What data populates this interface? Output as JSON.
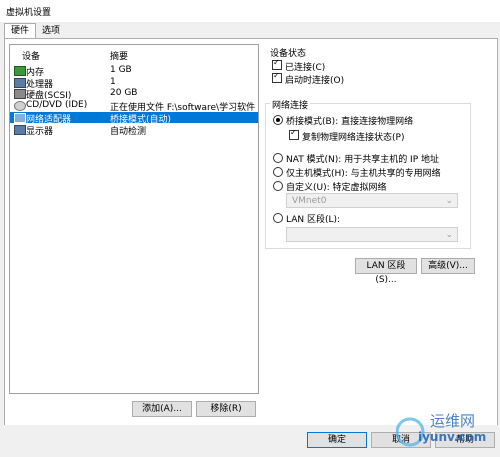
{
  "window": {
    "title": "虚拟机设置"
  },
  "tabs": [
    {
      "label": "硬件"
    },
    {
      "label": "选项"
    }
  ],
  "device_list": {
    "header_device": "设备",
    "header_summary": "摘要",
    "rows": [
      {
        "name": "内存",
        "summary": "1 GB",
        "icon": "memory-icon"
      },
      {
        "name": "处理器",
        "summary": "1",
        "icon": "processor-icon"
      },
      {
        "name": "硬盘(SCSI)",
        "summary": "20 GB",
        "icon": "harddisk-icon"
      },
      {
        "name": "CD/DVD (IDE)",
        "summary": "正在使用文件 F:\\software\\学习软件...",
        "icon": "cd-dvd-icon"
      },
      {
        "name": "网络适配器",
        "summary": "桥接模式(自动)",
        "icon": "network-adapter-icon"
      },
      {
        "name": "显示器",
        "summary": "自动检测",
        "icon": "display-icon"
      }
    ]
  },
  "buttons": {
    "add": "添加(A)...",
    "remove": "移除(R)",
    "lan_segments": "LAN 区段(S)...",
    "advanced": "高级(V)...",
    "ok": "确定",
    "cancel": "取消",
    "help": "帮助"
  },
  "device_status": {
    "title": "设备状态",
    "connected": "已连接(C)",
    "connect_at_power_on": "启动时连接(O)"
  },
  "network_connection": {
    "title": "网络连接",
    "bridged": "桥接模式(B): 直接连接物理网络",
    "replicate": "复制物理网络连接状态(P)",
    "nat": "NAT 模式(N): 用于共享主机的 IP 地址",
    "host_only": "仅主机模式(H): 与主机共享的专用网络",
    "custom": "自定义(U): 特定虚拟网络",
    "custom_value": "VMnet0",
    "lan_segment": "LAN 区段(L):",
    "lan_value": ""
  },
  "watermark": {
    "text": "运维网",
    "url": "iyunv.com"
  }
}
